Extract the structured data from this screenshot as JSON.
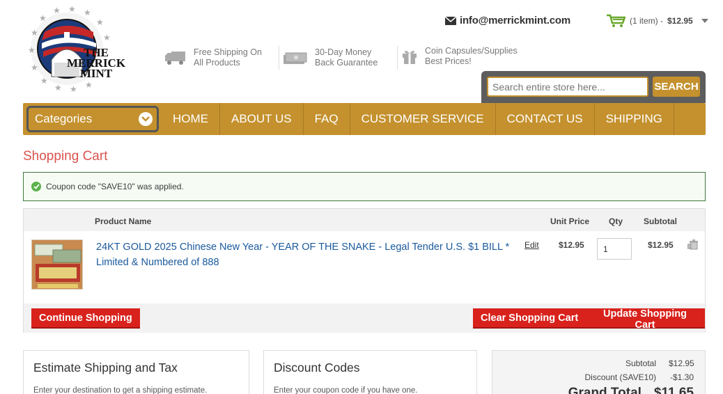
{
  "brand": {
    "logo_line1": "THE",
    "logo_line2": "MERRICK",
    "logo_line3": "MINT"
  },
  "header": {
    "email": "info@merrickmint.com",
    "minicart": {
      "count": "(1 item) -",
      "total": "$12.95"
    }
  },
  "features": [
    {
      "line1": "Free Shipping On",
      "line2": "All Products",
      "icon": "truck-icon"
    },
    {
      "line1": "30-Day Money",
      "line2": "Back Guarantee",
      "icon": "money-icon"
    },
    {
      "line1": "Coin Capsules/Supplies",
      "line2": "Best Prices!",
      "icon": "gift-icon"
    }
  ],
  "search": {
    "placeholder": "Search entire store here...",
    "button": "SEARCH"
  },
  "nav": {
    "categories": "Categories",
    "items": [
      "HOME",
      "ABOUT US",
      "FAQ",
      "CUSTOMER SERVICE",
      "CONTACT US",
      "SHIPPING"
    ]
  },
  "page": {
    "title": "Shopping Cart"
  },
  "message": {
    "text": "Coupon code \"SAVE10\" was applied."
  },
  "cart": {
    "headers": {
      "product": "Product Name",
      "unit": "Unit Price",
      "qty": "Qty",
      "subtotal": "Subtotal"
    },
    "items": [
      {
        "name": "24KT GOLD 2025 Chinese New Year - YEAR OF THE SNAKE - Legal Tender U.S. $1 BILL * Limited & Numbered of 888",
        "edit": "Edit",
        "unit_price": "$12.95",
        "qty": "1",
        "subtotal": "$12.95"
      }
    ],
    "buttons": {
      "continue": "Continue Shopping",
      "clear": "Clear Shopping Cart",
      "update": "Update Shopping Cart"
    }
  },
  "shipping_panel": {
    "title": "Estimate Shipping and Tax",
    "desc": "Enter your destination to get a shipping estimate."
  },
  "discount_panel": {
    "title": "Discount Codes",
    "desc": "Enter your coupon code if you have one."
  },
  "totals": {
    "subtotal_label": "Subtotal",
    "subtotal": "$12.95",
    "discount_label": "Discount (SAVE10)",
    "discount": "-$1.30",
    "grand_label": "Grand Total",
    "grand": "$11.65"
  },
  "colors": {
    "gold": "#c4912e",
    "red": "#d9221c",
    "link": "#1a5a9c",
    "title_red": "#d9534f"
  }
}
